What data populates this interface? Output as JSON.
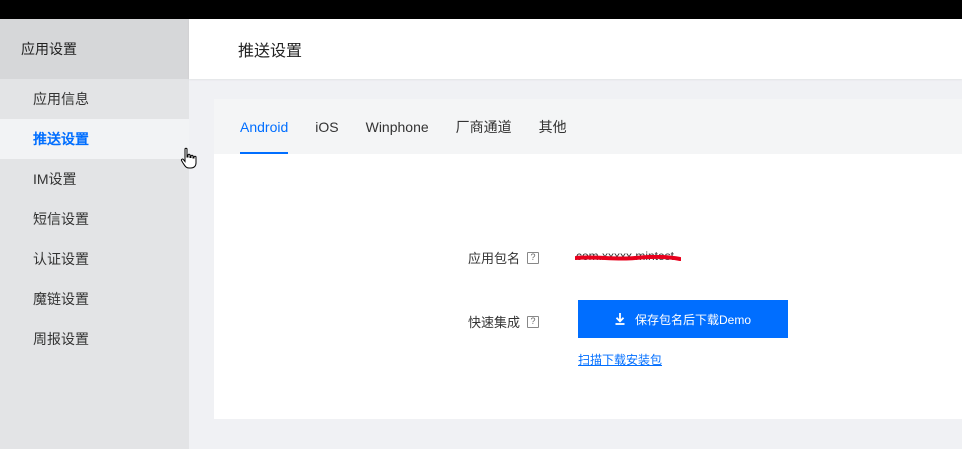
{
  "sidebar": {
    "header": "应用设置",
    "items": [
      {
        "label": "应用信息"
      },
      {
        "label": "推送设置"
      },
      {
        "label": "IM设置"
      },
      {
        "label": "短信设置"
      },
      {
        "label": "认证设置"
      },
      {
        "label": "魔链设置"
      },
      {
        "label": "周报设置"
      }
    ],
    "active_index": 1
  },
  "page": {
    "title": "推送设置"
  },
  "tabs": [
    {
      "label": "Android"
    },
    {
      "label": "iOS"
    },
    {
      "label": "Winphone"
    },
    {
      "label": "厂商通道"
    },
    {
      "label": "其他"
    }
  ],
  "form": {
    "package_label": "应用包名",
    "package_value": "com.xxxxx.mintest",
    "quick_label": "快速集成",
    "help_glyph": "?",
    "download_button": "保存包名后下载Demo",
    "scan_link": "扫描下载安装包"
  },
  "colors": {
    "accent": "#006eff",
    "redaction": "#e8001c"
  },
  "icons": [
    "help-icon",
    "download-icon",
    "hand-cursor-icon"
  ]
}
